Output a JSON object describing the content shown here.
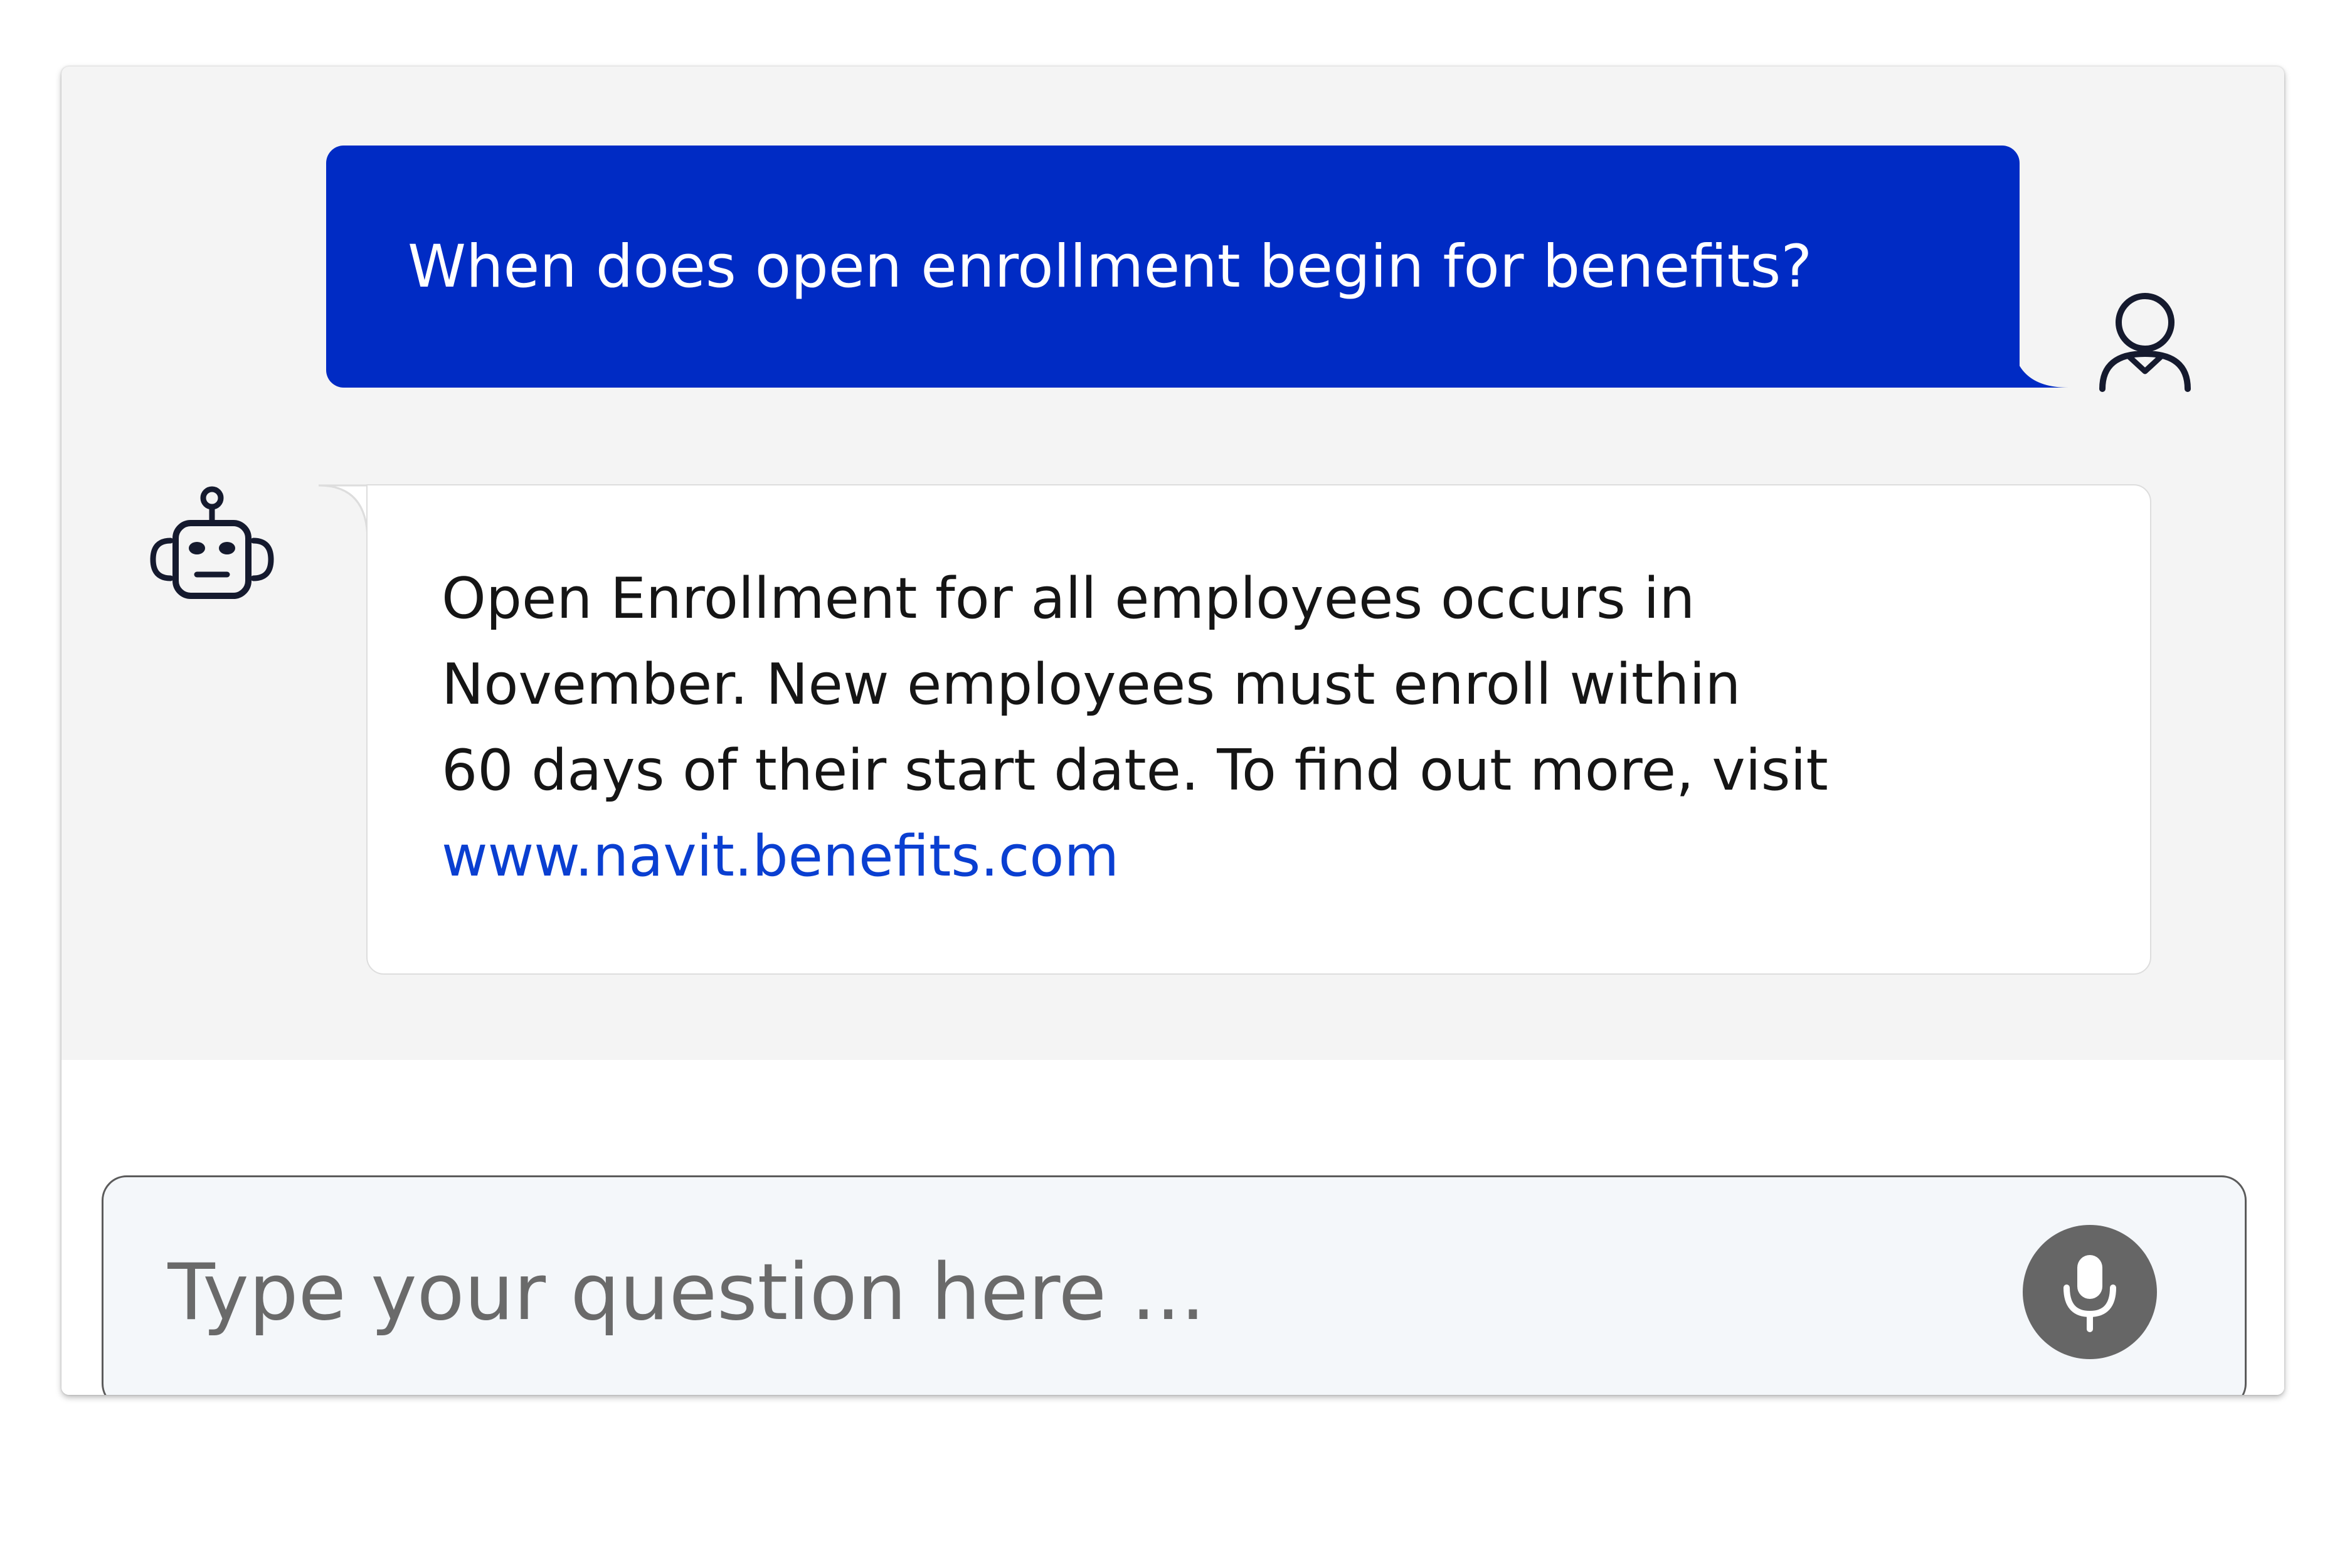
{
  "conversation": {
    "messages": [
      {
        "role": "user",
        "text": "When does open enrollment begin for benefits?",
        "avatar_icon": "user-icon"
      },
      {
        "role": "bot",
        "lines": [
          "Open Enrollment for all employees occurs in",
          "November. New employees must enroll within",
          "60 days of their start date. To find out more, visit"
        ],
        "link": "www.navit.benefits.com",
        "avatar_icon": "robot-icon"
      }
    ]
  },
  "composer": {
    "placeholder": "Type your question here ...",
    "mic_icon": "microphone-icon"
  },
  "colors": {
    "user_bubble": "#002bc4",
    "bot_bubble": "#ffffff",
    "window_background": "#f4f4f4",
    "link": "#0a3fd1",
    "mic_button": "#666666"
  }
}
